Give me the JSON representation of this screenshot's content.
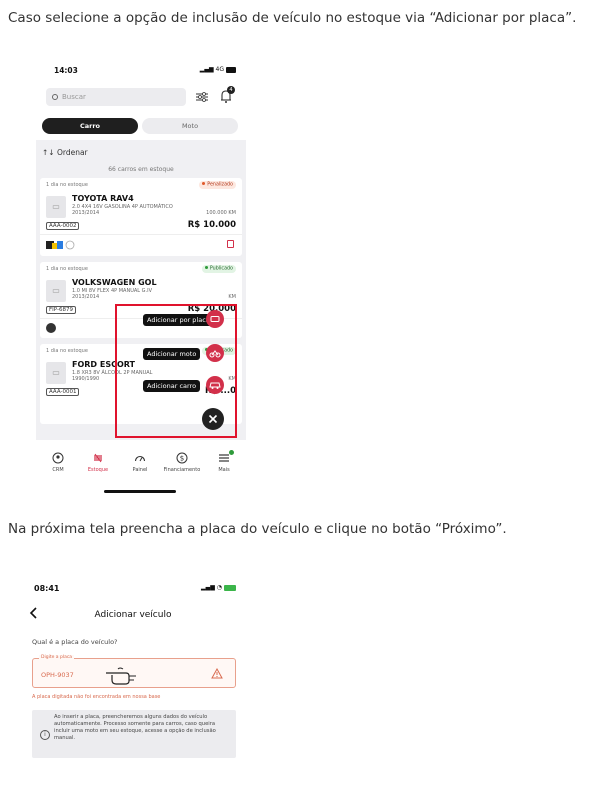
{
  "instructions": {
    "step1": "Caso selecione a opção de inclusão de veículo no estoque via “Adicionar por placa”.",
    "step2": "Na próxima tela preencha a placa do veículo e clique no botão “Próximo”."
  },
  "screen1": {
    "status": {
      "time": "14:03",
      "network": "4G"
    },
    "search_placeholder": "Buscar",
    "notification_count": "4",
    "segments": {
      "car": "Carro",
      "moto": "Moto"
    },
    "sort_label": "Ordenar",
    "stock_count": "66 carros em estoque",
    "cards": [
      {
        "days": "1 dia no estoque",
        "status": "Penalizado",
        "name": "TOYOTA RAV4",
        "spec": "2.0 4X4 16V GASOLINA 4P AUTOMÁTICO",
        "year": "2013/2014",
        "km": "100.000 KM",
        "plate": "AAA-0002",
        "price": "R$ 10.000"
      },
      {
        "days": "1 dia no estoque",
        "status": "Publicado",
        "name": "VOLKSWAGEN GOL",
        "spec": "1.0 MI 8V FLEX 4P MANUAL G.IV",
        "year": "2013/2014",
        "km": "KM",
        "plate": "FIP-6879",
        "price": "R$ 20.000"
      },
      {
        "days": "1 dia no estoque",
        "status": "Publicado",
        "name": "FORD ESCORT",
        "spec": "1.8 XR3 8V ÁLCOOL 2P MANUAL",
        "year": "1990/1990",
        "km": "KM",
        "plate": "AAA-0001",
        "price": "R$ ...0"
      }
    ],
    "fab_options": {
      "plate": "Adicionar por placa",
      "moto": "Adicionar moto",
      "car": "Adicionar carro"
    },
    "tabs": [
      {
        "label": "CRM",
        "icon": "crm-icon"
      },
      {
        "label": "Estoque",
        "icon": "stock-icon"
      },
      {
        "label": "Painel",
        "icon": "dashboard-icon"
      },
      {
        "label": "Financiamento",
        "icon": "financing-icon"
      },
      {
        "label": "Mais",
        "icon": "menu-icon"
      }
    ],
    "colors": {
      "brand_red": "#d2304a",
      "highlight_box": "#e0132d",
      "published_green": "#2e9a3a"
    }
  },
  "screen2": {
    "status": {
      "time": "08:41"
    },
    "title": "Adicionar veículo",
    "question": "Qual é a placa do veículo?",
    "plate_label": "Digite a placa",
    "plate_value": "OPH-9037",
    "error": "A placa digitada não foi encontrada em nossa base",
    "info": "Ao inserir a placa, preencheremos alguns dados do veículo automaticamente. Processo somente para carros, caso queira incluir uma moto em seu estoque, acesse a opção de inclusão manual."
  }
}
